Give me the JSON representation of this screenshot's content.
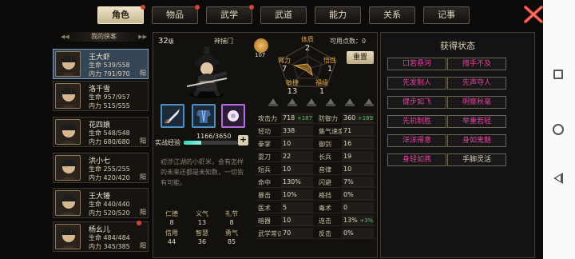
{
  "tabs": [
    {
      "label": "角色",
      "dot": true
    },
    {
      "label": "物品",
      "dot": true
    },
    {
      "label": "武学",
      "dot": true
    },
    {
      "label": "武道",
      "dot": false
    },
    {
      "label": "能力",
      "dot": false
    },
    {
      "label": "关系",
      "dot": false
    },
    {
      "label": "记事",
      "dot": false
    }
  ],
  "list_title": "我的侠客",
  "characters": [
    {
      "name": "王大虾",
      "hp": "生命 539/558",
      "mp": "内力 791/970",
      "tag": "阳",
      "selected": true
    },
    {
      "name": "洛千雪",
      "hp": "生命 957/957",
      "mp": "内力 515/555",
      "tag": ""
    },
    {
      "name": "花四娘",
      "hp": "生命 548/548",
      "mp": "内力 680/680",
      "tag": "阳"
    },
    {
      "name": "洪小七",
      "hp": "生命 255/255",
      "mp": "内力 420/420",
      "tag": "阳"
    },
    {
      "name": "王大锤",
      "hp": "生命 440/440",
      "mp": "内力 520/520",
      "tag": "阳"
    },
    {
      "name": "杨幺儿",
      "hp": "生命 484/484",
      "mp": "内力 345/385",
      "tag": "阳",
      "dot": true
    }
  ],
  "profile": {
    "level": "32",
    "level_unit": "级",
    "faction": "神捕门",
    "exp_label": "实战经验",
    "exp_text": "1166/3650",
    "exp_fraction": 0.319,
    "exp_plus": "+",
    "bio": "初涉江湖的小虾米，会有怎样的未来还都是未知数，一切皆有可能。",
    "fate_value": "107",
    "points_label": "可用点数：0",
    "reset_label": "重置"
  },
  "attributes": [
    {
      "k": "体质",
      "v": "2"
    },
    {
      "k": "臂力",
      "v": "7"
    },
    {
      "k": "悟性",
      "v": "1"
    },
    {
      "k": "敏捷",
      "v": "13"
    },
    {
      "k": "福缘",
      "v": "1"
    }
  ],
  "virtues": [
    {
      "k": "仁德",
      "v": "8"
    },
    {
      "k": "义气",
      "v": "13"
    },
    {
      "k": "礼节",
      "v": "8"
    },
    {
      "k": "信用",
      "v": "44"
    },
    {
      "k": "智慧",
      "v": "36"
    },
    {
      "k": "勇气",
      "v": "85"
    }
  ],
  "stats_left": [
    {
      "k": "攻击力",
      "v": "718",
      "b": "+187"
    },
    {
      "k": "轻功",
      "v": "338",
      "b": ""
    },
    {
      "k": "拳掌",
      "v": "10",
      "b": ""
    },
    {
      "k": "耍刀",
      "v": "22",
      "b": ""
    },
    {
      "k": "短兵",
      "v": "10",
      "b": ""
    },
    {
      "k": "命中",
      "v": "130%",
      "b": ""
    },
    {
      "k": "暴击",
      "v": "10%",
      "b": ""
    },
    {
      "k": "医术",
      "v": "5",
      "b": ""
    },
    {
      "k": "暗器",
      "v": "10",
      "b": ""
    },
    {
      "k": "武学常识",
      "v": "70",
      "b": ""
    }
  ],
  "stats_right": [
    {
      "k": "防御力",
      "v": "360",
      "b": "+189"
    },
    {
      "k": "集气速度",
      "v": "71",
      "b": ""
    },
    {
      "k": "御剑",
      "v": "16",
      "b": ""
    },
    {
      "k": "长兵",
      "v": "19",
      "b": ""
    },
    {
      "k": "音律",
      "v": "10",
      "b": ""
    },
    {
      "k": "闪避",
      "v": "7%",
      "b": ""
    },
    {
      "k": "格挡",
      "v": "0%",
      "b": ""
    },
    {
      "k": "毒术",
      "v": "0",
      "b": ""
    },
    {
      "k": "连击",
      "v": "13%",
      "b": "+3%"
    },
    {
      "k": "反击",
      "v": "0%",
      "b": ""
    }
  ],
  "states_title": "获得状态",
  "states": [
    {
      "label": "口若悬河",
      "c": "pink"
    },
    {
      "label": "措手不及",
      "c": "pink"
    },
    {
      "label": "先发制人",
      "c": "pink"
    },
    {
      "label": "先声夺人",
      "c": "pink"
    },
    {
      "label": "健步如飞",
      "c": "pink"
    },
    {
      "label": "明察秋毫",
      "c": "pink"
    },
    {
      "label": "先机制胜",
      "c": "pink"
    },
    {
      "label": "举重若轻",
      "c": "pink"
    },
    {
      "label": "洋洋得意",
      "c": "pink"
    },
    {
      "label": "身如鬼魅",
      "c": "pink"
    },
    {
      "label": "身轻如燕",
      "c": "pink"
    },
    {
      "label": "手脚灵活",
      "c": "white"
    }
  ]
}
